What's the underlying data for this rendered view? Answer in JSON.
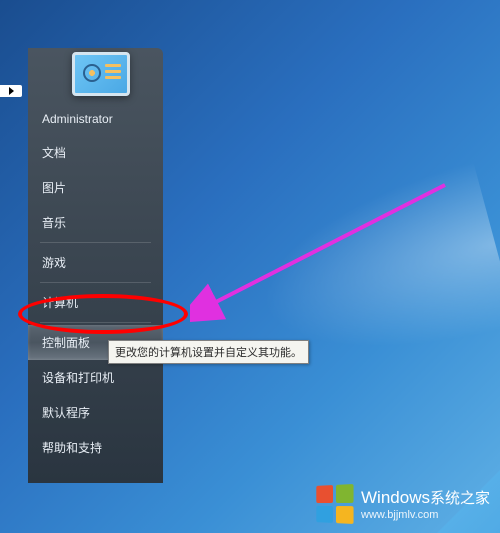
{
  "user": {
    "name": "Administrator"
  },
  "menu": {
    "items": [
      {
        "label": "文档"
      },
      {
        "label": "图片"
      },
      {
        "label": "音乐"
      },
      {
        "label": "游戏"
      },
      {
        "label": "计算机"
      },
      {
        "label": "控制面板",
        "highlighted": true
      },
      {
        "label": "设备和打印机"
      },
      {
        "label": "默认程序"
      },
      {
        "label": "帮助和支持"
      }
    ]
  },
  "tooltip": {
    "text": "更改您的计算机设置并自定义其功能。"
  },
  "watermark": {
    "brand": "Windows",
    "suffix": "系统之家",
    "url": "www.bjjmlv.com"
  }
}
